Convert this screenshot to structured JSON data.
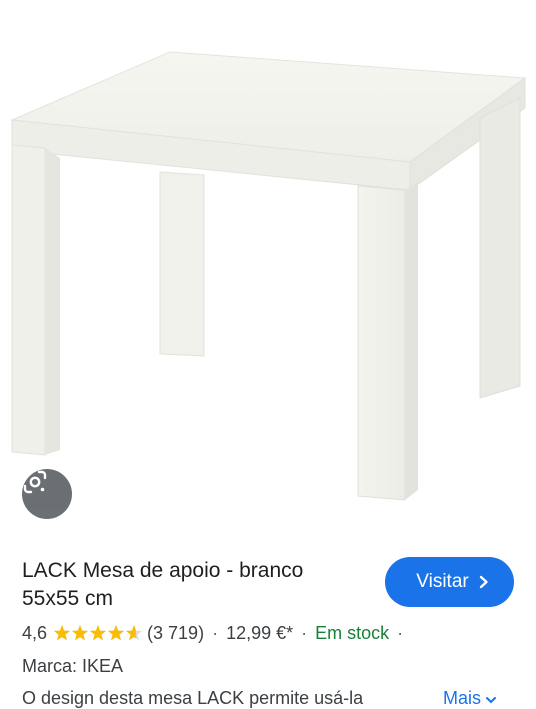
{
  "product": {
    "title_line1": "LACK Mesa de apoio - branco",
    "title_line2": "55x55 cm",
    "image_icon": "white-side-table-image"
  },
  "actions": {
    "visit_label": "Visitar",
    "lens_icon": "google-lens-icon"
  },
  "rating": {
    "value": "4,6",
    "stars": 4.6,
    "count": "(3 719)",
    "price": "12,99 €*",
    "availability": "Em stock",
    "separator": "·"
  },
  "details": {
    "brand": "Marca: IKEA",
    "description": "O design desta mesa LACK permite usá-la",
    "more_label": "Mais"
  },
  "colors": {
    "accent": "#1a73e8",
    "stock": "#188038",
    "star": "#fbbc04"
  }
}
